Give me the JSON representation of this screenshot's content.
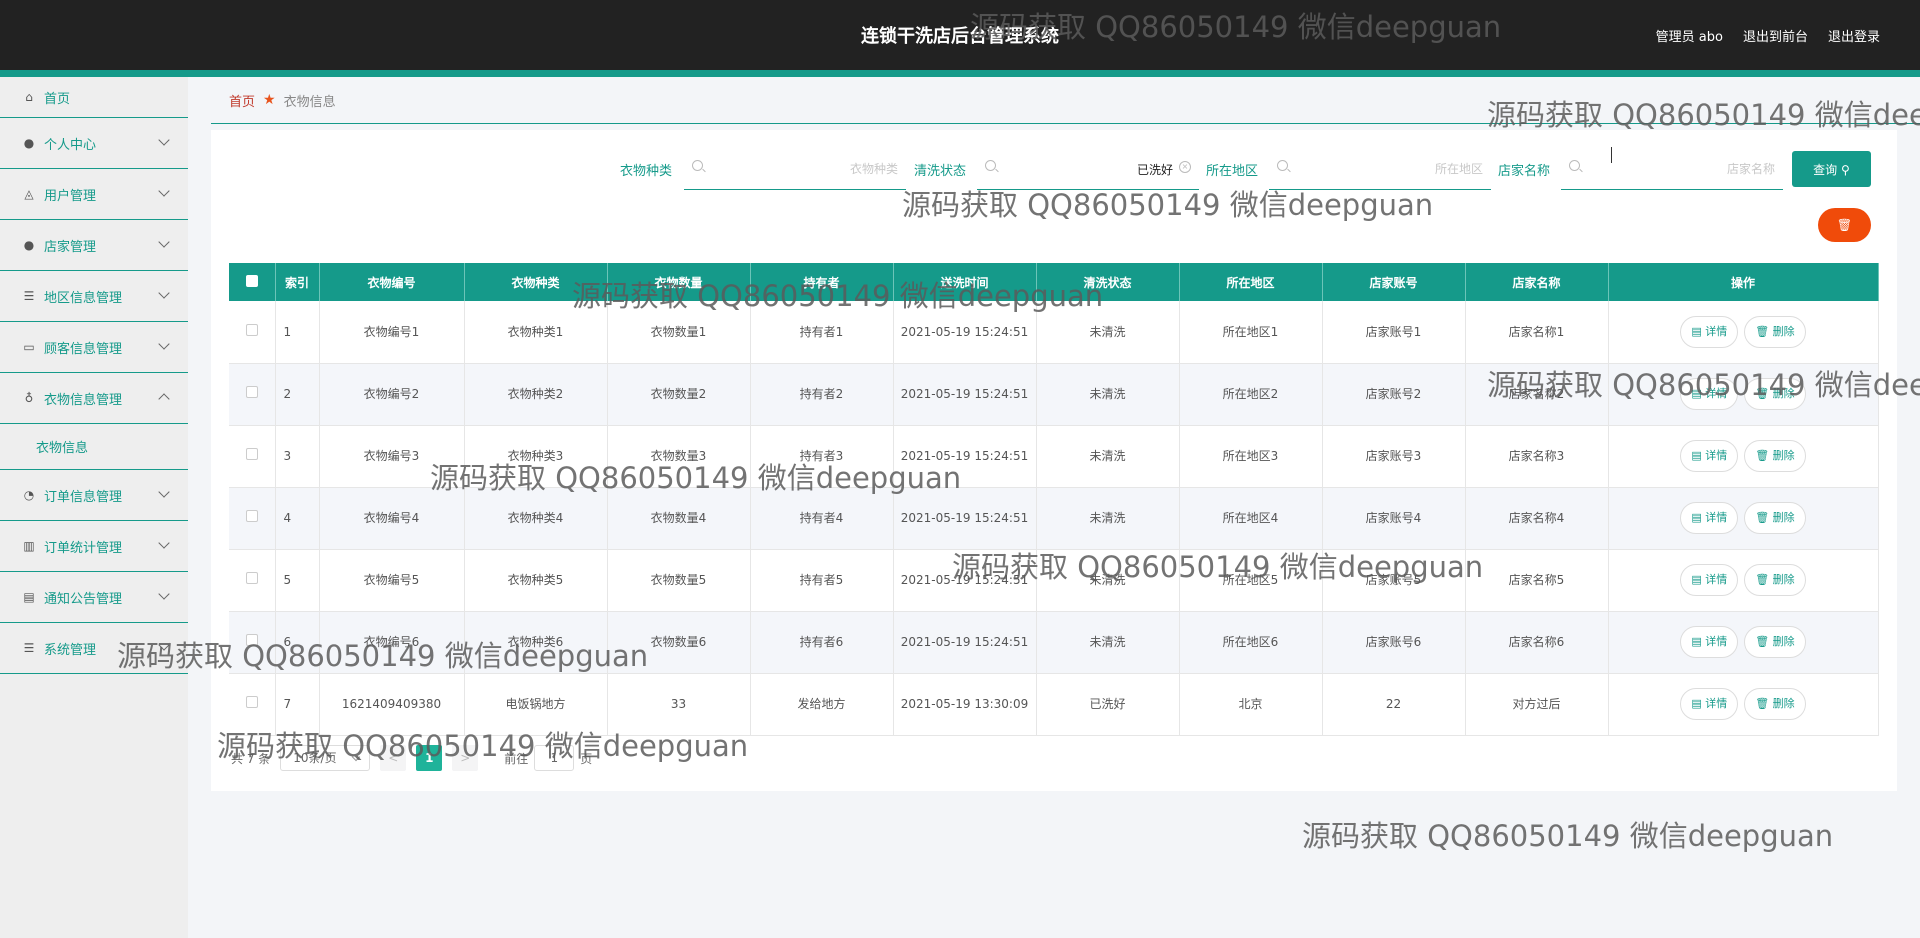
{
  "header": {
    "title": "连锁干洗店后台管理系统",
    "admin": "管理员 abo",
    "back_front": "退出到前台",
    "logout": "退出登录"
  },
  "sidebar": {
    "items": [
      {
        "label": "首页",
        "icon": "home-icon",
        "expandable": false
      },
      {
        "label": "个人中心",
        "icon": "user-icon",
        "expandable": true
      },
      {
        "label": "用户管理",
        "icon": "bell-icon",
        "expandable": true
      },
      {
        "label": "店家管理",
        "icon": "user-icon",
        "expandable": true
      },
      {
        "label": "地区信息管理",
        "icon": "list-icon",
        "expandable": true
      },
      {
        "label": "顾客信息管理",
        "icon": "card-icon",
        "expandable": true
      },
      {
        "label": "衣物信息管理",
        "icon": "mic-icon",
        "expandable": true,
        "expanded": true
      },
      {
        "label": "订单信息管理",
        "icon": "gauge-icon",
        "expandable": true
      },
      {
        "label": "订单统计管理",
        "icon": "bar-chart-icon",
        "expandable": true
      },
      {
        "label": "通知公告管理",
        "icon": "printer-icon",
        "expandable": true
      },
      {
        "label": "系统管理",
        "icon": "list-icon",
        "expandable": true
      }
    ],
    "sub_item": "衣物信息"
  },
  "breadcrumb": {
    "home": "首页",
    "current": "衣物信息"
  },
  "search": {
    "type_label": "衣物种类",
    "type_placeholder": "衣物种类",
    "type_value": "",
    "status_label": "清洗状态",
    "status_placeholder": "清洗状态",
    "status_value": "已洗好",
    "region_label": "所在地区",
    "region_placeholder": "所在地区",
    "region_value": "",
    "shop_label": "店家名称",
    "shop_placeholder": "店家名称",
    "shop_value": "",
    "query_label": "查询"
  },
  "table": {
    "headers": [
      "索引",
      "衣物编号",
      "衣物种类",
      "衣物数量",
      "持有者",
      "送洗时间",
      "清洗状态",
      "所在地区",
      "店家账号",
      "店家名称",
      "操作"
    ],
    "detail_label": "详情",
    "delete_label": "删除",
    "rows": [
      {
        "idx": "1",
        "code": "衣物编号1",
        "type": "衣物种类1",
        "qty": "衣物数量1",
        "owner": "持有者1",
        "time": "2021-05-19 15:24:51",
        "status": "未清洗",
        "region": "所在地区1",
        "shop_account": "店家账号1",
        "shop_name": "店家名称1"
      },
      {
        "idx": "2",
        "code": "衣物编号2",
        "type": "衣物种类2",
        "qty": "衣物数量2",
        "owner": "持有者2",
        "time": "2021-05-19 15:24:51",
        "status": "未清洗",
        "region": "所在地区2",
        "shop_account": "店家账号2",
        "shop_name": "店家名称2"
      },
      {
        "idx": "3",
        "code": "衣物编号3",
        "type": "衣物种类3",
        "qty": "衣物数量3",
        "owner": "持有者3",
        "time": "2021-05-19 15:24:51",
        "status": "未清洗",
        "region": "所在地区3",
        "shop_account": "店家账号3",
        "shop_name": "店家名称3"
      },
      {
        "idx": "4",
        "code": "衣物编号4",
        "type": "衣物种类4",
        "qty": "衣物数量4",
        "owner": "持有者4",
        "time": "2021-05-19 15:24:51",
        "status": "未清洗",
        "region": "所在地区4",
        "shop_account": "店家账号4",
        "shop_name": "店家名称4"
      },
      {
        "idx": "5",
        "code": "衣物编号5",
        "type": "衣物种类5",
        "qty": "衣物数量5",
        "owner": "持有者5",
        "time": "2021-05-19 15:24:51",
        "status": "未清洗",
        "region": "所在地区5",
        "shop_account": "店家账号5",
        "shop_name": "店家名称5"
      },
      {
        "idx": "6",
        "code": "衣物编号6",
        "type": "衣物种类6",
        "qty": "衣物数量6",
        "owner": "持有者6",
        "time": "2021-05-19 15:24:51",
        "status": "未清洗",
        "region": "所在地区6",
        "shop_account": "店家账号6",
        "shop_name": "店家名称6"
      },
      {
        "idx": "7",
        "code": "1621409409380",
        "type": "电饭锅地方",
        "qty": "33",
        "owner": "发给地方",
        "time": "2021-05-19 13:30:09",
        "status": "已洗好",
        "region": "北京",
        "shop_account": "22",
        "shop_name": "对方过后"
      }
    ]
  },
  "pagination": {
    "total": "共 7 条",
    "page_size": "10条/页",
    "prev": "<",
    "current_page": "1",
    "next": ">",
    "goto_label": "前往",
    "goto_value": "1",
    "page_suffix": "页"
  },
  "watermark": "源码获取 QQ86050149 微信deepguan",
  "colors": {
    "accent": "#159a8a",
    "danger": "#f04b0a",
    "header_bg": "#222222"
  }
}
